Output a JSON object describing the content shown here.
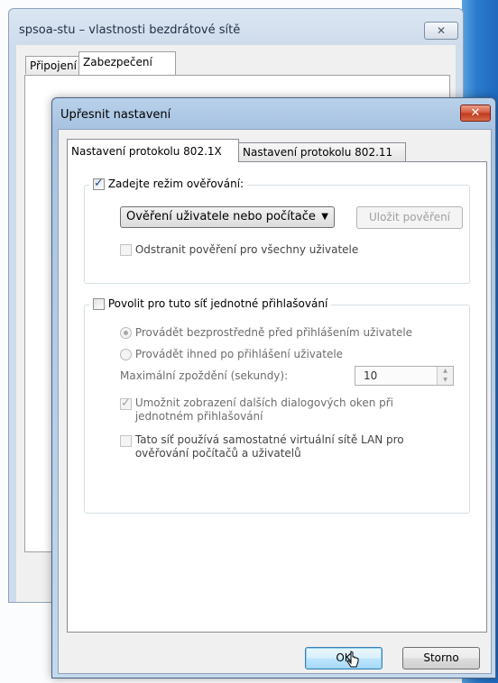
{
  "back_window": {
    "title": "spsoa-stu – vlastnosti bezdrátové sítě",
    "close_glyph": "✕",
    "tabs": [
      {
        "label": "Připojení"
      },
      {
        "label": "Zabezpečení"
      }
    ]
  },
  "dialog": {
    "title": "Upřesnit nastavení",
    "close_glyph": "✕",
    "tabs": [
      {
        "label": "Nastavení protokolu 802.1X",
        "selected": true
      },
      {
        "label": "Nastavení protokolu 802.11",
        "selected": false
      }
    ],
    "auth_group": {
      "checkbox_label": "Zadejte režim ověřování:",
      "checked": true,
      "mode_select_value": "Ověření uživatele nebo počítače",
      "save_credentials_label": "Uložit pověření",
      "remove_credentials_label": "Odstranit pověření pro všechny uživatele"
    },
    "sso_group": {
      "checkbox_label": "Povolit pro tuto síť jednotné přihlašování",
      "checked": false,
      "radio_before_label": "Provádět bezprostředně před přihlášením uživatele",
      "radio_after_label": "Provádět ihned po přihlášení uživatele",
      "delay_label": "Maximální zpoždění (sekundy):",
      "delay_value": "10",
      "allow_dialogs_label_line1": "Umožnit zobrazení dalších dialogových oken při",
      "allow_dialogs_label_line2": "jednotném přihlašování",
      "vlan_label_line1": "Tato síť používá samostatné virtuální sítě LAN pro",
      "vlan_label_line2": "ověřování počítačů a uživatelů"
    },
    "ok_label": "OK",
    "cancel_label": "Storno"
  }
}
